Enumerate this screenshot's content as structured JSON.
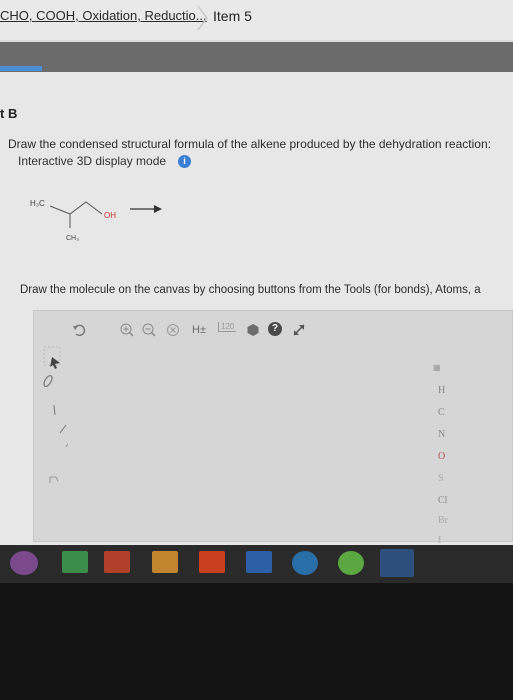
{
  "tabs": {
    "assignment_label": "CHO, COOH, Oxidation, Reductio...",
    "item_label": "Item 5"
  },
  "part": {
    "title": "t B",
    "question": "Draw the condensed structural formula of the alkene produced by the dehydration reaction:",
    "mode_label": "Interactive 3D display mode",
    "info_icon": "i"
  },
  "molecule": {
    "h3c": "H₃C",
    "oh": "OH",
    "ch3": "CH₃"
  },
  "canvas": {
    "instructions": "Draw the molecule on the canvas by choosing buttons from the Tools (for bonds), Atoms, a"
  },
  "toolbar": {
    "undo_icon": "undo-icon",
    "zoom_in_icon": "zoom-in-icon",
    "zoom_out_icon": "zoom-out-icon",
    "reset_icon": "reset-icon",
    "hydrogen_label": "H±",
    "template_label": "120",
    "help_icon": "?"
  },
  "elements": {
    "list": [
      "H",
      "C",
      "N",
      "O",
      "S",
      "Cl",
      "Br",
      "I"
    ]
  },
  "colors": {
    "accent": "#3b7fd4",
    "panel_bg": "#e7e7e7",
    "header_bar": "#6b6b6b"
  }
}
